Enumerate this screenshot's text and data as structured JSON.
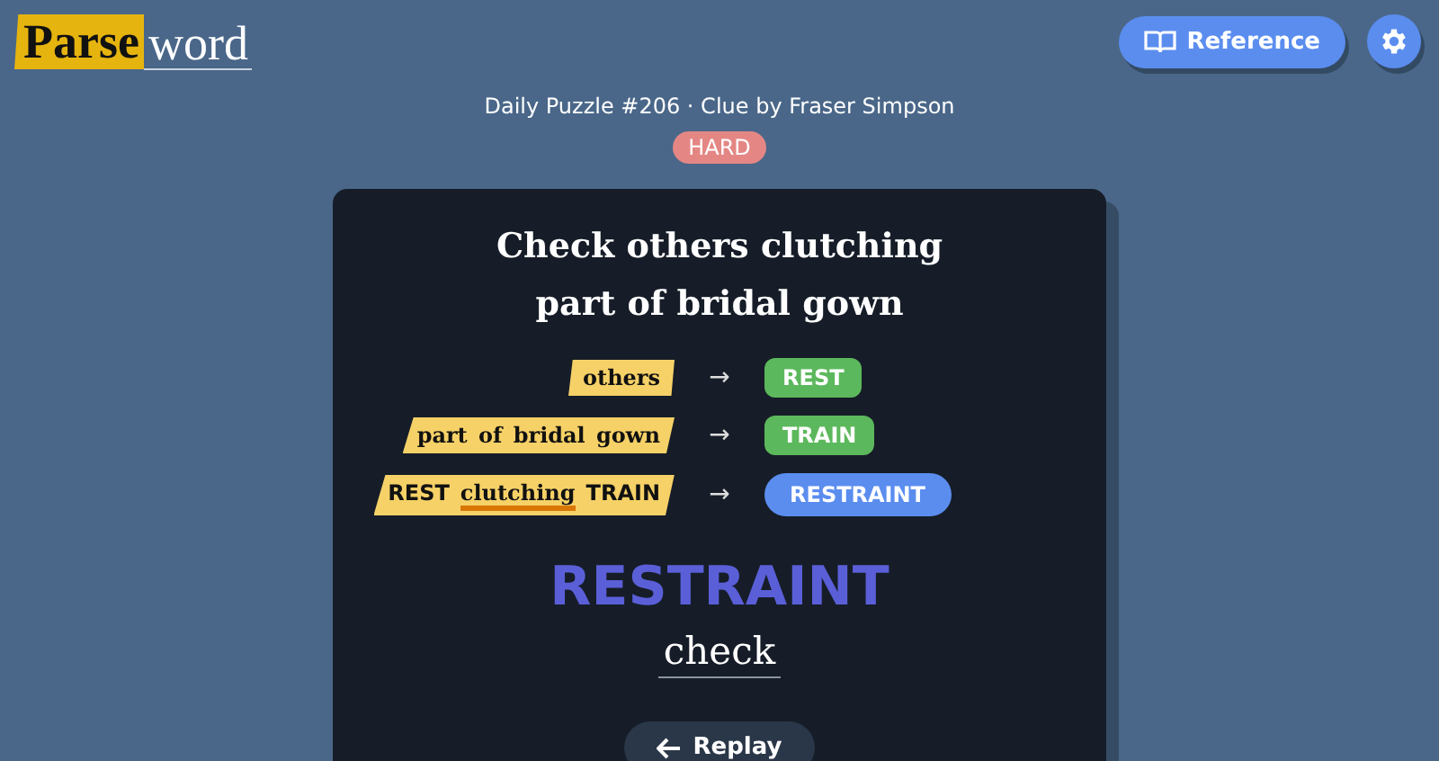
{
  "logo": {
    "part_1": "Parse",
    "part_2": "word"
  },
  "header_buttons": {
    "reference": "Reference"
  },
  "subtitle": "Daily Puzzle #206 · Clue by Fraser Simpson",
  "difficulty": "HARD",
  "clue": {
    "line_1": "Check others clutching",
    "line_2": "part of bridal gown"
  },
  "steps": [
    {
      "parts": [
        {
          "kind": "fodder",
          "text": "others"
        }
      ],
      "arrow": "→",
      "result": "REST",
      "color": "#5cb85c"
    },
    {
      "parts": [
        {
          "kind": "fodder",
          "text": "part of bridal gown"
        }
      ],
      "arrow": "→",
      "result": "TRAIN",
      "color": "#5cb85c"
    },
    {
      "parts": [
        {
          "kind": "word",
          "text": "REST"
        },
        {
          "kind": "indicator",
          "text": "clutching"
        },
        {
          "kind": "word",
          "text": "TRAIN"
        }
      ],
      "arrow": "→",
      "result": "RESTRAINT",
      "color": "#5b8def"
    }
  ],
  "answer": "RESTRAINT",
  "definition": "check",
  "replay": "Replay"
}
